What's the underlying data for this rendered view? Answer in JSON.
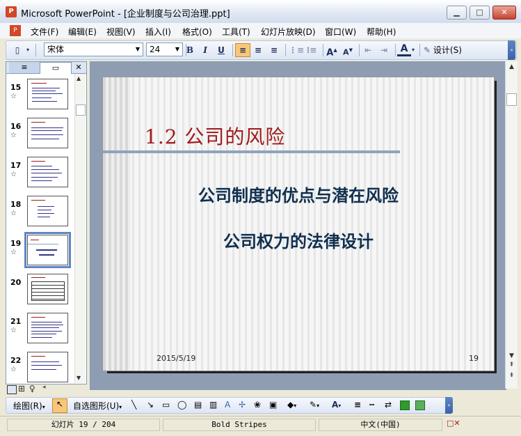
{
  "window": {
    "app_icon_label": "P",
    "title": "Microsoft PowerPoint - [企业制度与公司治理.ppt]",
    "minimize": "▁",
    "maximize": "□",
    "close": "✕"
  },
  "menu": [
    "文件(F)",
    "编辑(E)",
    "视图(V)",
    "插入(I)",
    "格式(O)",
    "工具(T)",
    "幻灯片放映(D)",
    "窗口(W)",
    "帮助(H)"
  ],
  "toolbar": {
    "font_name": "宋体",
    "font_size": "24",
    "bold": "B",
    "italic": "I",
    "underline": "U",
    "design_label": "设计(S)"
  },
  "panel": {
    "tab_outline_icon": "≡",
    "tab_slides_icon": "▭",
    "close": "✕"
  },
  "thumbnails": [
    {
      "num": "15",
      "star": "☆"
    },
    {
      "num": "16",
      "star": "☆"
    },
    {
      "num": "17",
      "star": "☆"
    },
    {
      "num": "18",
      "star": "☆"
    },
    {
      "num": "19",
      "star": "☆"
    },
    {
      "num": "20",
      "star": ""
    },
    {
      "num": "21",
      "star": "☆"
    },
    {
      "num": "22",
      "star": "☆"
    }
  ],
  "slide": {
    "heading": "1.2 公司的风险",
    "line1": "公司制度的优点与潜在风险",
    "line2": "公司权力的法律设计",
    "date": "2015/5/19",
    "number": "19"
  },
  "drawbar": {
    "draw_label": "绘图(R)",
    "autoshapes_label": "自选图形(U)"
  },
  "status": {
    "slide_pos": "幻灯片 19 / 204",
    "template": "Bold Stripes",
    "language": "中文(中国)"
  },
  "colors": {
    "heading": "#a11a1a",
    "body_text": "#0f2f4f",
    "selection": "#5f86c4"
  }
}
